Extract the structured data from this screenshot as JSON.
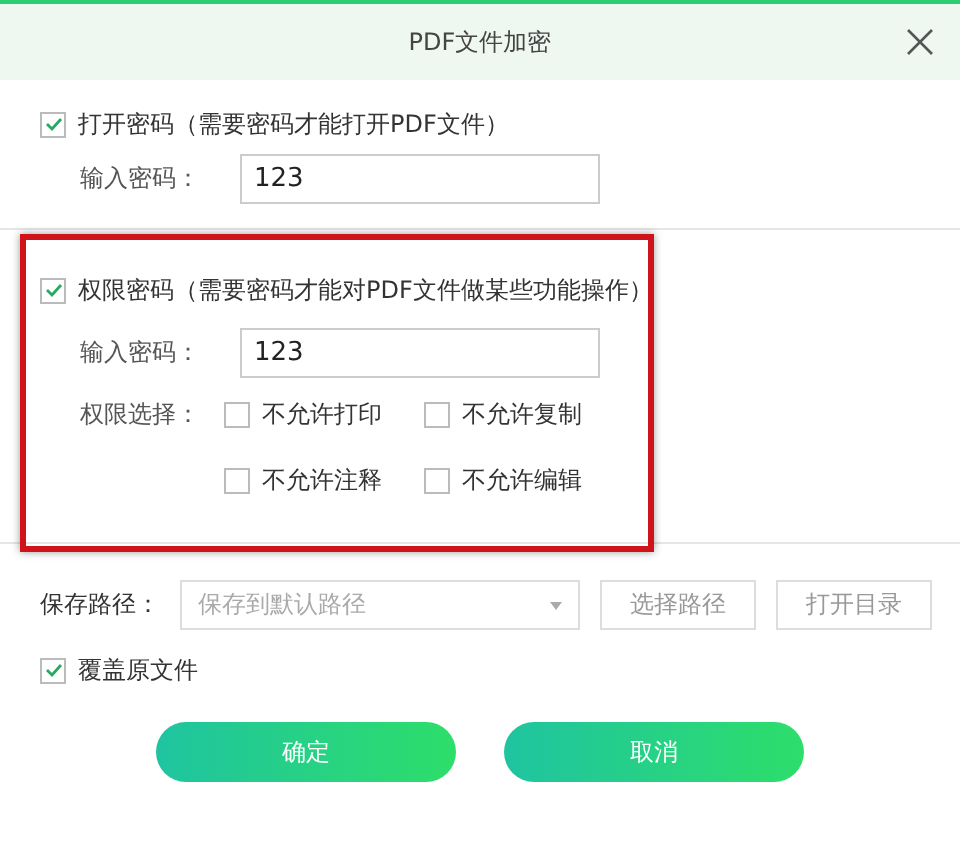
{
  "window": {
    "title": "PDF文件加密"
  },
  "open_password": {
    "checked": true,
    "label": "打开密码（需要密码才能打开PDF文件）",
    "field_label": "输入密码：",
    "value": "123"
  },
  "permission_password": {
    "checked": true,
    "label": "权限密码（需要密码才能对PDF文件做某些功能操作）",
    "field_label": "输入密码：",
    "value": "123",
    "permissions_label": "权限选择：",
    "permissions": [
      {
        "label": "不允许打印",
        "checked": false
      },
      {
        "label": "不允许复制",
        "checked": false
      },
      {
        "label": "不允许注释",
        "checked": false
      },
      {
        "label": "不允许编辑",
        "checked": false
      }
    ]
  },
  "save_path": {
    "label": "保存路径：",
    "placeholder": "保存到默认路径",
    "buttons": [
      "选择路径",
      "打开目录"
    ]
  },
  "overwrite": {
    "checked": true,
    "label": "覆盖原文件"
  },
  "buttons": [
    "确定",
    "取消"
  ]
}
